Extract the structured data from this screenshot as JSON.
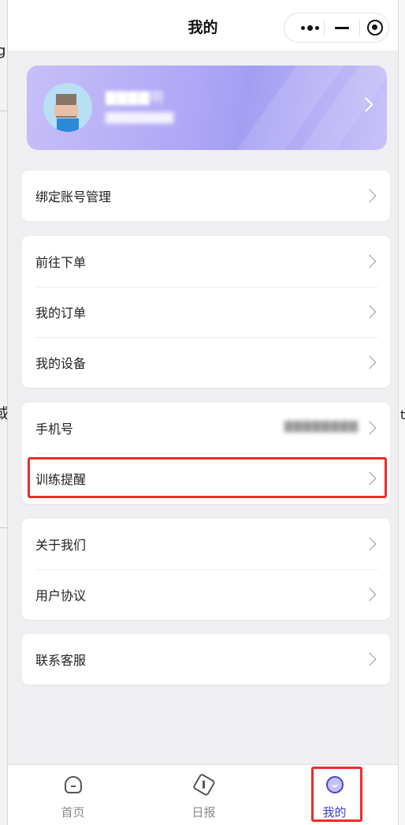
{
  "navbar": {
    "title": "我的"
  },
  "profile": {
    "name": "▇▇▇▇明",
    "sub": "▇▇▇▇▇▇▇▇"
  },
  "groups": {
    "account": {
      "bind": "绑定账号管理"
    },
    "orders": {
      "order": "前往下单",
      "my_orders": "我的订单",
      "my_devices": "我的设备"
    },
    "settings": {
      "phone_label": "手机号",
      "phone_value": "▇▇▇▇▇▇▇▇",
      "reminder": "训练提醒"
    },
    "about": {
      "about_us": "关于我们",
      "agreement": "用户协议"
    },
    "service": {
      "contact": "联系客服"
    }
  },
  "tabbar": {
    "home": "首页",
    "report": "日报",
    "mine": "我的",
    "active": "mine",
    "active_color": "#3d3dd6"
  },
  "background": {
    "left_fragment_1": "g",
    "left_fragment_2": "或",
    "right_fragment": "t"
  },
  "colors": {
    "highlight": "#ee2b2b",
    "card_gradient_start": "#c7bff7",
    "card_gradient_end": "#a49ef3"
  }
}
